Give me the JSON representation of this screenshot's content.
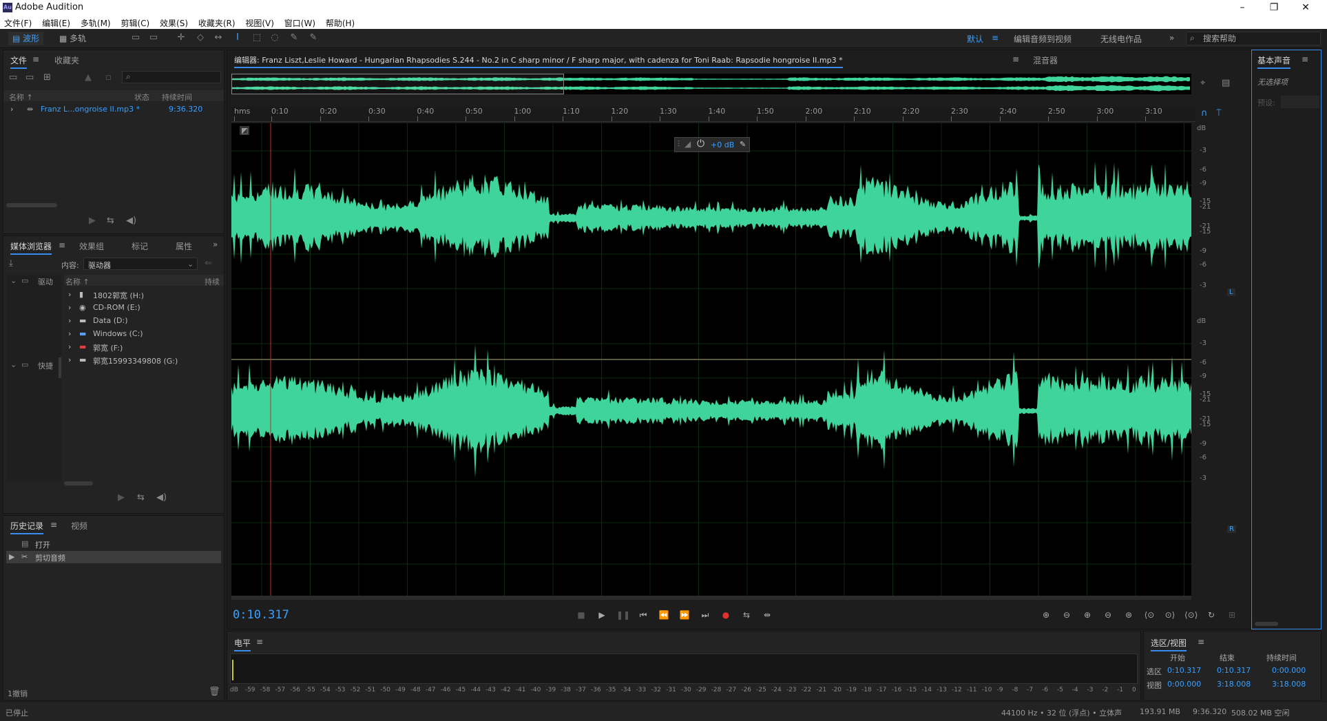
{
  "window": {
    "title": "Adobe Audition",
    "app_icon": "Au",
    "minimize": "–",
    "maximize": "❐",
    "close": "✕"
  },
  "menu": [
    "文件(F)",
    "编辑(E)",
    "多轨(M)",
    "剪辑(C)",
    "效果(S)",
    "收藏夹(R)",
    "视图(V)",
    "窗口(W)",
    "帮助(H)"
  ],
  "toolbar": {
    "waveform": "波形",
    "multitrack": "多轨",
    "workspaces": [
      "默认",
      "编辑音频到视频",
      "无线电作品"
    ],
    "more": "»",
    "search_placeholder": "搜索帮助"
  },
  "files_panel": {
    "tabs": [
      "文件",
      "收藏夹"
    ],
    "col_name": "名称 ↑",
    "col_status": "状态",
    "col_duration": "持续时间",
    "file": {
      "name": "Franz L...ongroise II.mp3 *",
      "duration": "9:36.320"
    }
  },
  "media_browser": {
    "tabs": [
      "媒体浏览器",
      "效果组",
      "标记",
      "属性"
    ],
    "more": "»",
    "content_label": "内容:",
    "content_value": "驱动器",
    "tree": [
      "驱动",
      "快捷"
    ],
    "col_name": "名称 ↑",
    "col_duration": "持续",
    "drives": [
      "1802郭宽 (H:)",
      "CD-ROM (E:)",
      "Data (D:)",
      "Windows (C:)",
      "郭宽 (F:)",
      "郭宽15993349808 (G:)"
    ]
  },
  "history": {
    "tabs": [
      "历史记录",
      "视频"
    ],
    "items": [
      "打开",
      "剪切音频"
    ],
    "undo": "1撤销"
  },
  "editor": {
    "tab": "编辑器: Franz Liszt,Leslie Howard - Hungarian Rhapsodies S.244 - No.2 in C sharp minor  /  F sharp major, with cadenza for Toni Raab:  Rapsodie hongroise II.mp3 *",
    "mixer_tab": "混音器",
    "hud_gain": "+0 dB",
    "ruler": [
      "hms",
      "0:10",
      "0:20",
      "0:30",
      "0:40",
      "0:50",
      "1:00",
      "1:10",
      "1:20",
      "1:30",
      "1:40",
      "1:50",
      "2:00",
      "2:10",
      "2:20",
      "2:30",
      "2:40",
      "2:50",
      "3:00",
      "3:10"
    ],
    "db_labels": [
      "dB",
      "-3",
      "-6",
      "-9",
      "-15",
      "-21",
      "-21",
      "-15",
      "-9",
      "-6",
      "-3"
    ],
    "ch_left": "L",
    "ch_right": "R",
    "timecode": "0:10.317",
    "wave_color": "#3ed49a",
    "playhead_color": "#c0302f"
  },
  "essential_sound": {
    "title": "基本声音",
    "none_selected": "无选择项",
    "preset": "预设:"
  },
  "meter": {
    "title": "电平",
    "scale": [
      "dB",
      "-59",
      "-58",
      "-57",
      "-56",
      "-55",
      "-54",
      "-53",
      "-52",
      "-51",
      "-50",
      "-49",
      "-48",
      "-47",
      "-46",
      "-45",
      "-44",
      "-43",
      "-42",
      "-41",
      "-40",
      "-39",
      "-38",
      "-37",
      "-36",
      "-35",
      "-34",
      "-33",
      "-32",
      "-31",
      "-30",
      "-29",
      "-28",
      "-27",
      "-26",
      "-25",
      "-24",
      "-23",
      "-22",
      "-21",
      "-20",
      "-19",
      "-18",
      "-17",
      "-16",
      "-15",
      "-14",
      "-13",
      "-12",
      "-11",
      "-10",
      "-9",
      "-8",
      "-7",
      "-6",
      "-5",
      "-4",
      "-3",
      "-2",
      "-1",
      "0"
    ]
  },
  "selection_view": {
    "title": "选区/视图",
    "headers": [
      "开始",
      "结束",
      "持续时间"
    ],
    "rows": [
      {
        "label": "选区",
        "start": "0:10.317",
        "end": "0:10.317",
        "duration": "0:00.000"
      },
      {
        "label": "视图",
        "start": "0:00.000",
        "end": "3:18.008",
        "duration": "3:18.008"
      }
    ]
  },
  "status": {
    "left": "已停止",
    "sample_rate": "44100 Hz • 32 位 (浮点)  • 立体声",
    "size": "193.91 MB",
    "duration": "9:36.320",
    "free": "508.02 MB 空闲"
  }
}
